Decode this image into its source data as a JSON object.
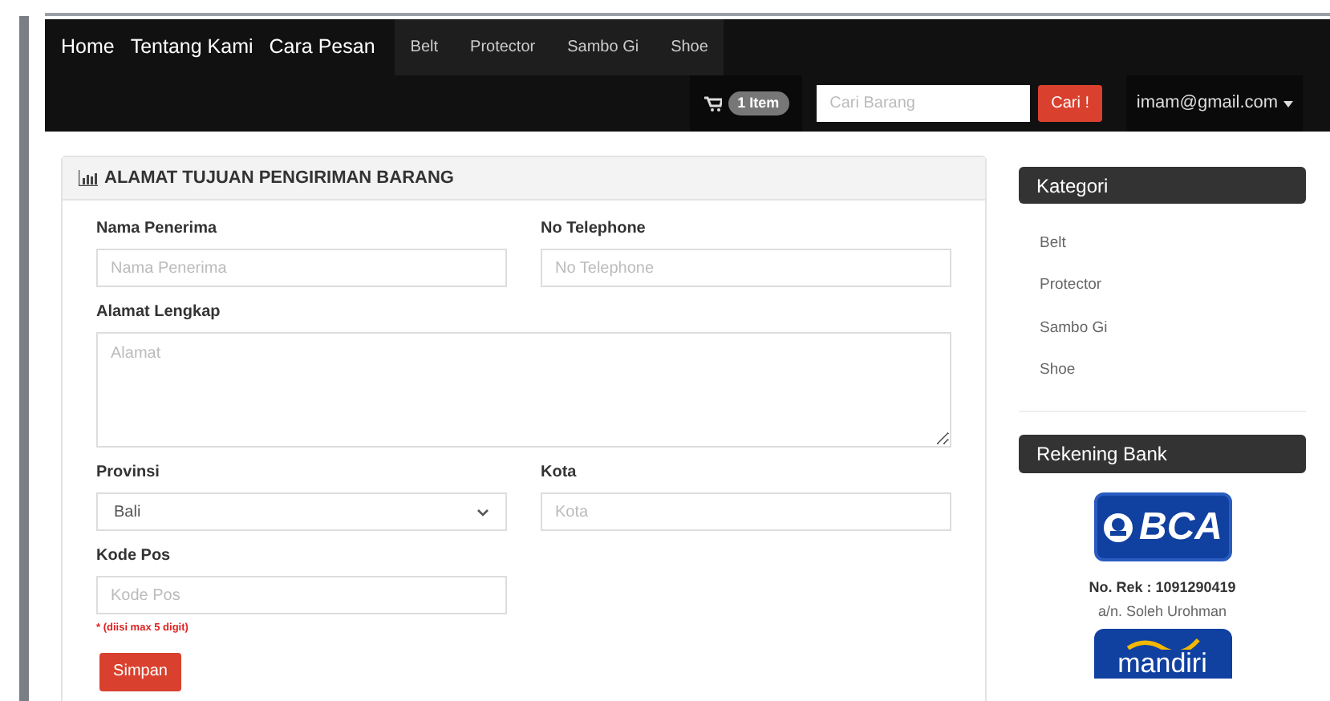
{
  "navbar": {
    "brand_links": [
      "Home",
      "Tentang Kami",
      "Cara Pesan"
    ],
    "category_links": [
      "Belt",
      "Protector",
      "Sambo Gi",
      "Shoe"
    ],
    "cart": {
      "badge": "1 Item"
    },
    "search": {
      "placeholder": "Cari Barang",
      "button": "Cari !"
    },
    "user_menu": "imam@gmail.com"
  },
  "form_panel": {
    "title": "ALAMAT TUJUAN PENGIRIMAN BARANG",
    "fields": [
      {
        "kind": "input",
        "label": "Nama Penerima",
        "placeholder": "Nama Penerima"
      },
      {
        "kind": "input",
        "label": "No Telephone",
        "placeholder": "No Telephone"
      },
      {
        "kind": "textarea",
        "label": "Alamat Lengkap",
        "placeholder": "Alamat"
      },
      {
        "kind": "select",
        "label": "Provinsi",
        "value": "Bali"
      },
      {
        "kind": "input",
        "label": "Kota",
        "placeholder": "Kota"
      },
      {
        "kind": "input",
        "label": "Kode Pos",
        "placeholder": "Kode Pos",
        "hint": "* (diisi max 5 digit)"
      }
    ],
    "submit": "Simpan"
  },
  "sidebar": {
    "category_title": "Kategori",
    "categories": [
      "Belt",
      "Protector",
      "Sambo Gi",
      "Shoe"
    ],
    "bank_title": "Rekening Bank",
    "banks": [
      {
        "logo": "BCA",
        "account": "No. Rek : 1091290419",
        "holder": "a/n. Soleh Urohman"
      },
      {
        "logo": "mandiri"
      }
    ]
  }
}
